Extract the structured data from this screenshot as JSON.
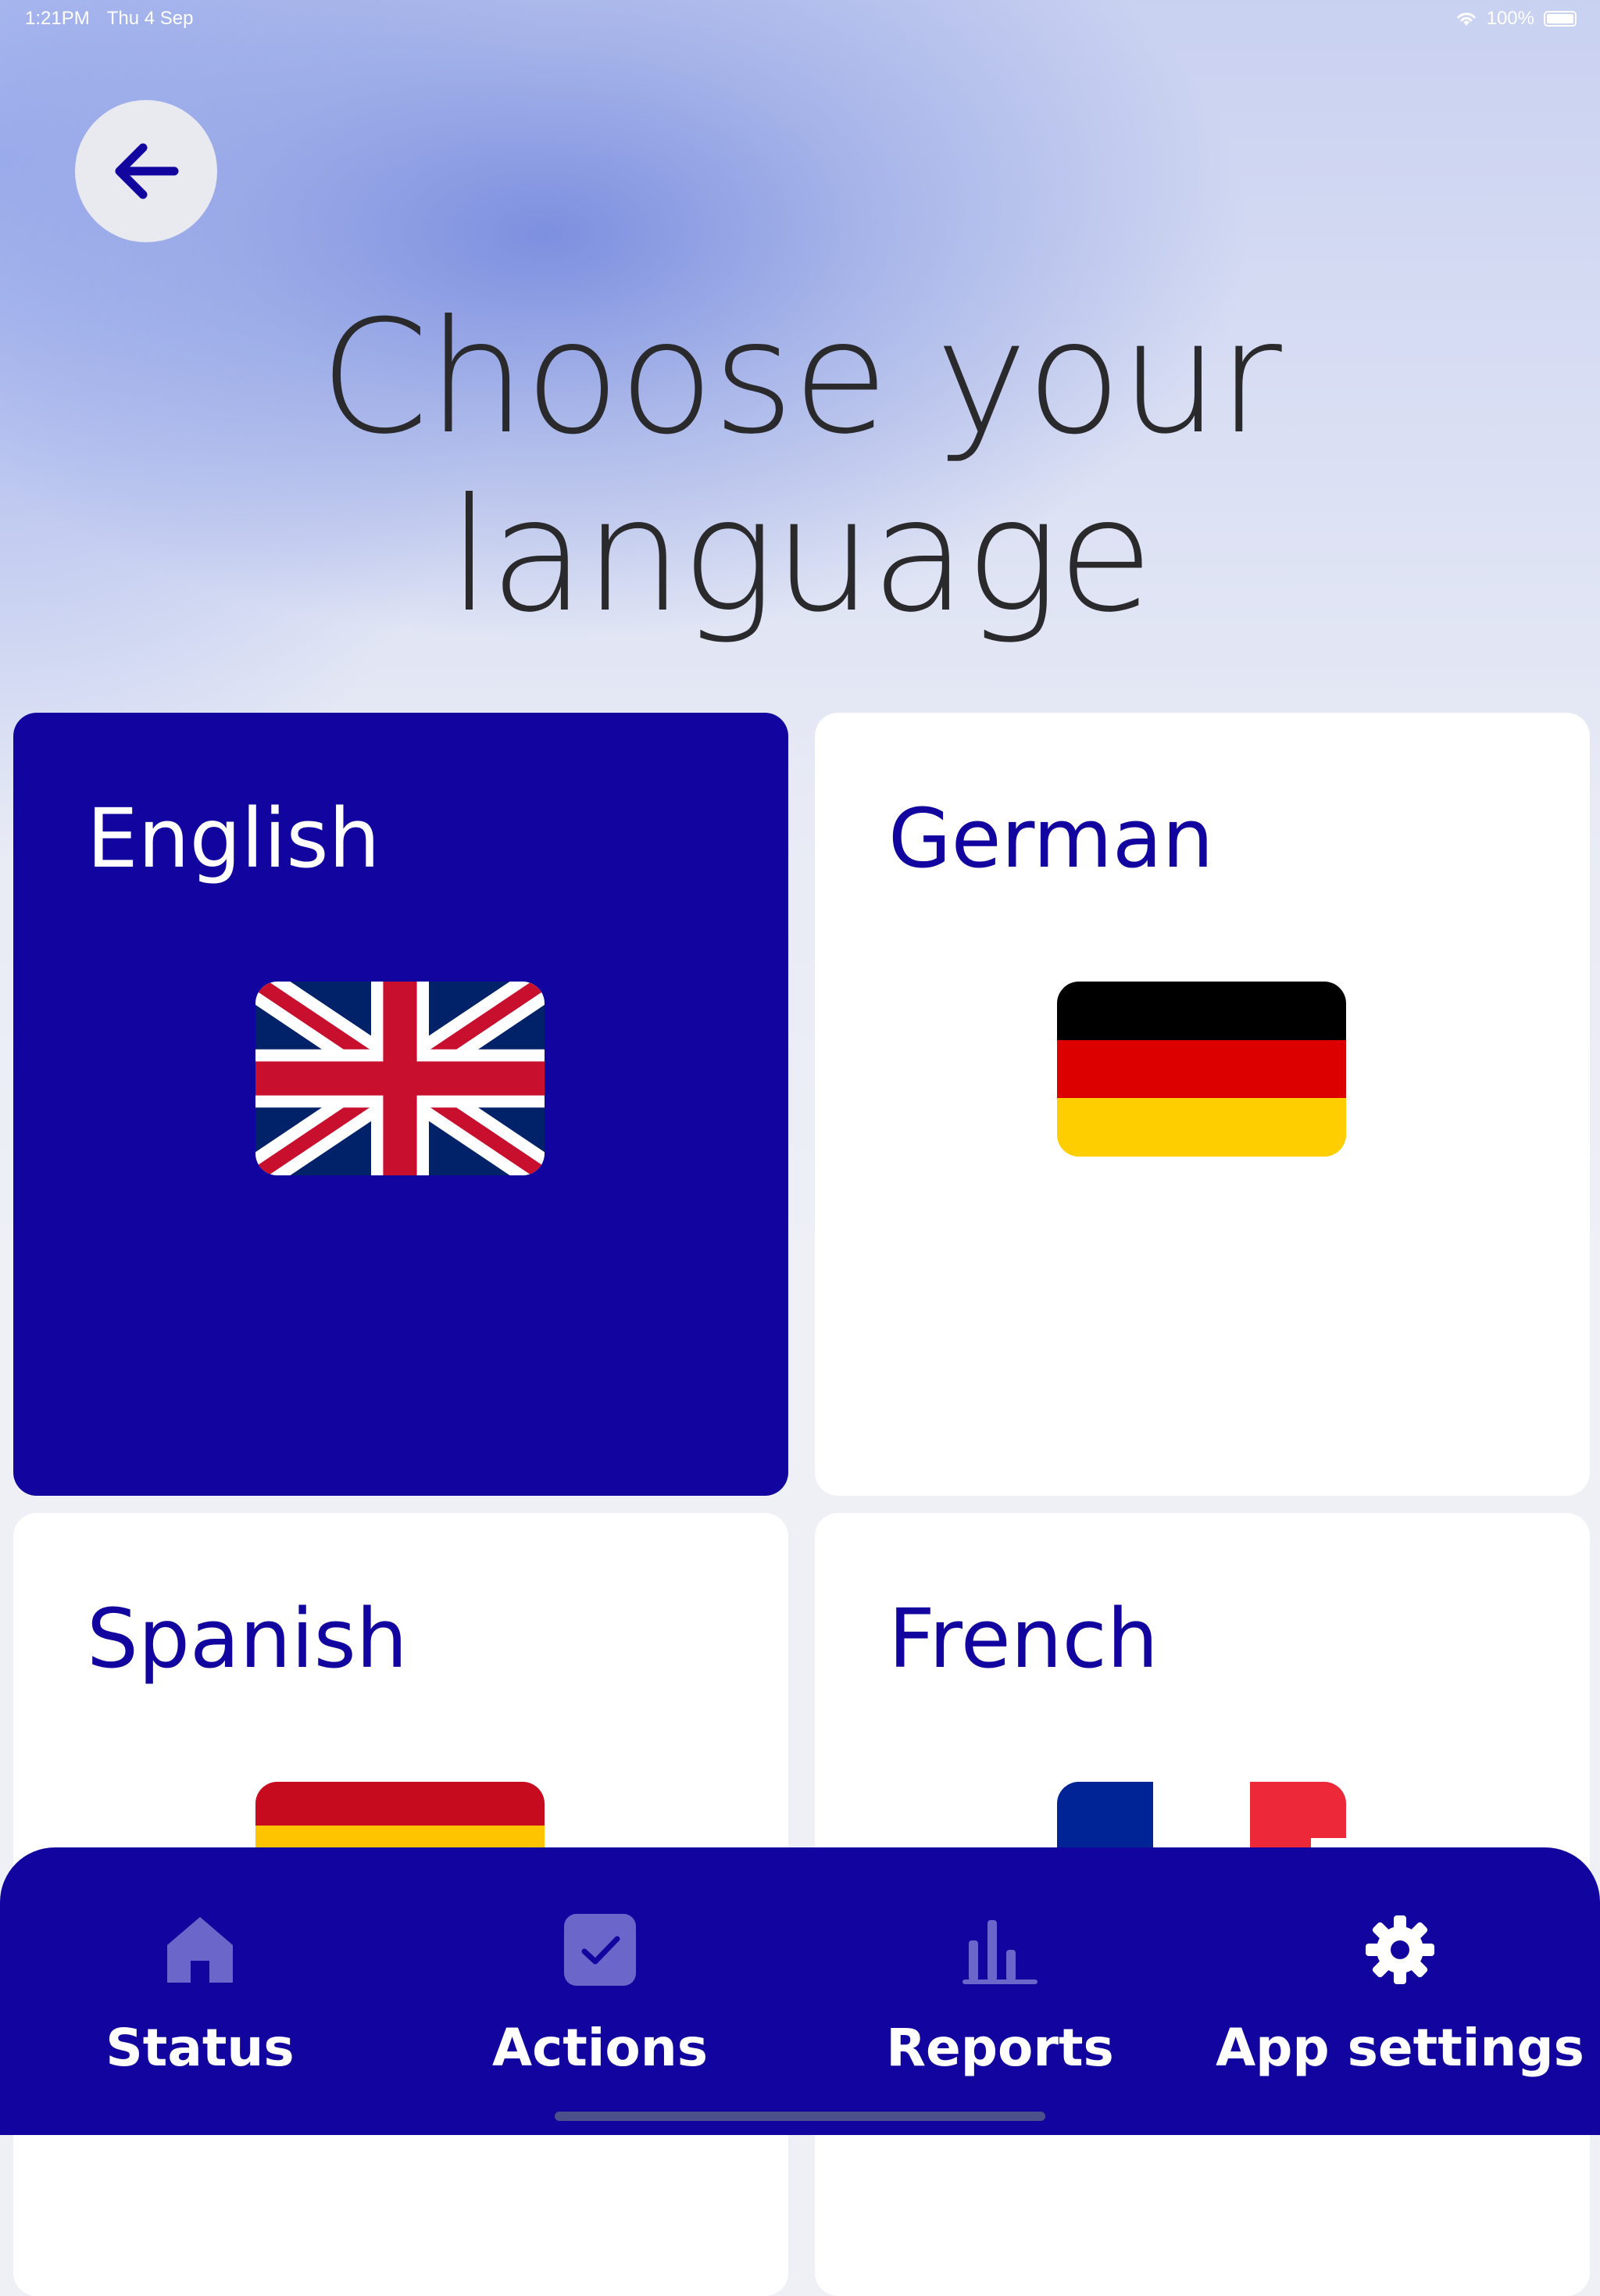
{
  "status_bar": {
    "time": "1:21PM",
    "date": "Thu 4 Sep",
    "battery": "100%"
  },
  "page": {
    "title_line1": "Choose your",
    "title_line2": "language"
  },
  "languages": [
    {
      "label": "English",
      "flag": "uk-flag-icon",
      "selected": true
    },
    {
      "label": "German",
      "flag": "germany-flag-icon",
      "selected": false
    },
    {
      "label": "Spanish",
      "flag": "spain-flag-icon",
      "selected": false
    },
    {
      "label": "French",
      "flag": "france-flag-icon",
      "selected": false
    }
  ],
  "bottom_nav": {
    "items": [
      {
        "label": "Status",
        "icon": "home-icon"
      },
      {
        "label": "Actions",
        "icon": "checkbox-icon"
      },
      {
        "label": "Reports",
        "icon": "bar-chart-icon"
      },
      {
        "label": "App settings",
        "icon": "gear-icon",
        "active": true
      }
    ]
  },
  "colors": {
    "brand": "#12059f",
    "card": "#ffffff",
    "title_text": "#2a2a2d",
    "inactive_icon": "#6b66c9"
  }
}
